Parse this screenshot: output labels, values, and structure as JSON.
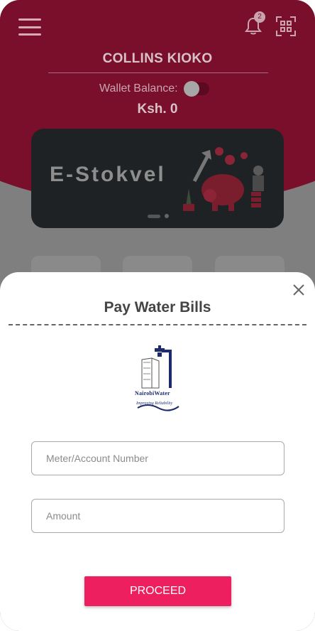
{
  "header": {
    "user_name": "COLLINS KIOKO",
    "wallet_label": "Wallet Balance:",
    "balance": "Ksh. 0",
    "notification_count": "2"
  },
  "banner": {
    "title": "E-Stokvel"
  },
  "modal": {
    "title": "Pay Water Bills",
    "logo_name": "NairobiWater",
    "logo_tagline": "Improving Reliability",
    "meter_placeholder": "Meter/Account Number",
    "amount_placeholder": "Amount",
    "proceed_label": "PROCEED"
  },
  "colors": {
    "brand": "#7a0f2c",
    "accent": "#ee1f5f",
    "logo_blue": "#1d2a6b"
  },
  "icons": [
    "menu-icon",
    "bell-icon",
    "qr-scan-icon",
    "close-icon",
    "nairobi-water-logo"
  ]
}
